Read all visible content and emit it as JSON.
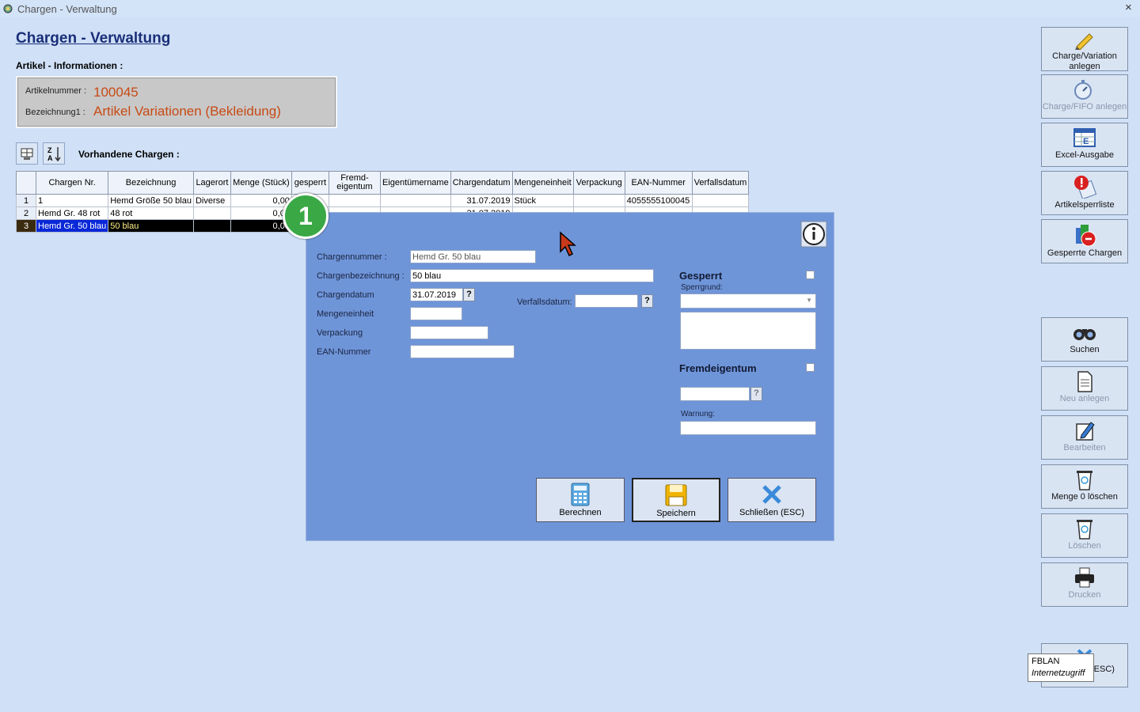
{
  "window": {
    "title": "Chargen - Verwaltung",
    "close": "×"
  },
  "page_title": "Chargen - Verwaltung",
  "artikel": {
    "header": "Artikel - Informationen :",
    "nr_label": "Artikelnummer :",
    "nr_value": "100045",
    "bez_label": "Bezeichnung1 :",
    "bez_value": "Artikel Variationen (Bekleidung)"
  },
  "vorhandene": "Vorhandene Chargen :",
  "table": {
    "headers": [
      "Chargen Nr.",
      "Bezeichnung",
      "Lagerort",
      "Menge (Stück)",
      "gesperrt",
      "Fremd-\neigentum",
      "Eigentümername",
      "Chargendatum",
      "Mengeneinheit",
      "Verpackung",
      "EAN-Nummer",
      "Verfallsdatum"
    ],
    "rows": [
      {
        "n": "1",
        "nr": "1",
        "bez": "Hemd Größe 50 blau",
        "lager": "Diverse",
        "menge": "0,00",
        "datum": "31.07.2019",
        "einheit": "Stück",
        "ean": "4055555100045"
      },
      {
        "n": "2",
        "nr": "Hemd Gr. 48 rot",
        "bez": "48 rot",
        "lager": "",
        "menge": "0,00",
        "datum": "31.07.2019",
        "einheit": "",
        "ean": ""
      },
      {
        "n": "3",
        "nr": "Hemd Gr. 50 blau",
        "bez": "50 blau",
        "lager": "",
        "menge": "0,00",
        "datum": "",
        "einheit": "",
        "ean": ""
      }
    ]
  },
  "right_buttons": [
    {
      "label": "Charge/Variation anlegen",
      "icon": "pencil-icon"
    },
    {
      "label": "Charge/FIFO anlegen",
      "icon": "stopwatch-icon"
    },
    {
      "label": "Excel-Ausgabe",
      "icon": "excel-icon"
    },
    {
      "label": "Artikelsperrliste",
      "icon": "warning-icon"
    },
    {
      "label": "Gesperrte Chargen",
      "icon": "blocked-icon"
    },
    {
      "label": "Suchen",
      "icon": "binoculars-icon"
    },
    {
      "label": "Neu anlegen",
      "icon": "document-icon"
    },
    {
      "label": "Bearbeiten",
      "icon": "edit-icon"
    },
    {
      "label": "Menge 0 löschen",
      "icon": "trash-icon"
    },
    {
      "label": "Löschen",
      "icon": "trash-icon"
    },
    {
      "label": "Drucken",
      "icon": "printer-icon"
    },
    {
      "label": "(ESC)",
      "icon": "close-icon"
    }
  ],
  "dialog": {
    "chargennummer_label": "Chargennummer :",
    "chargennummer_value": "Hemd Gr. 50 blau",
    "chargenbez_label": "Chargenbezeichnung :",
    "chargenbez_value": "50 blau",
    "chargendatum_label": "Chargendatum",
    "chargendatum_value": "31.07.2019",
    "mengeneinheit_label": "Mengeneinheit",
    "verpackung_label": "Verpackung",
    "ean_label": "EAN-Nummer",
    "verfall_label": "Verfallsdatum:",
    "q": "?",
    "gesperrt_label": "Gesperrt",
    "sperrgrund_label": "Sperrgrund:",
    "fremd_label": "Fremdeigentum",
    "warnung_label": "Warnung:",
    "berechnen": "Berechnen",
    "speichern": "Speichern",
    "schliessen": "Schließen (ESC)"
  },
  "badge": "1",
  "tooltip": {
    "line1": "FBLAN",
    "line2": "Internetzugriff"
  },
  "colors": {
    "accent": "#1a2e78",
    "value": "#c84a14",
    "dialog": "#6f95d9",
    "badge": "#3aa845"
  }
}
